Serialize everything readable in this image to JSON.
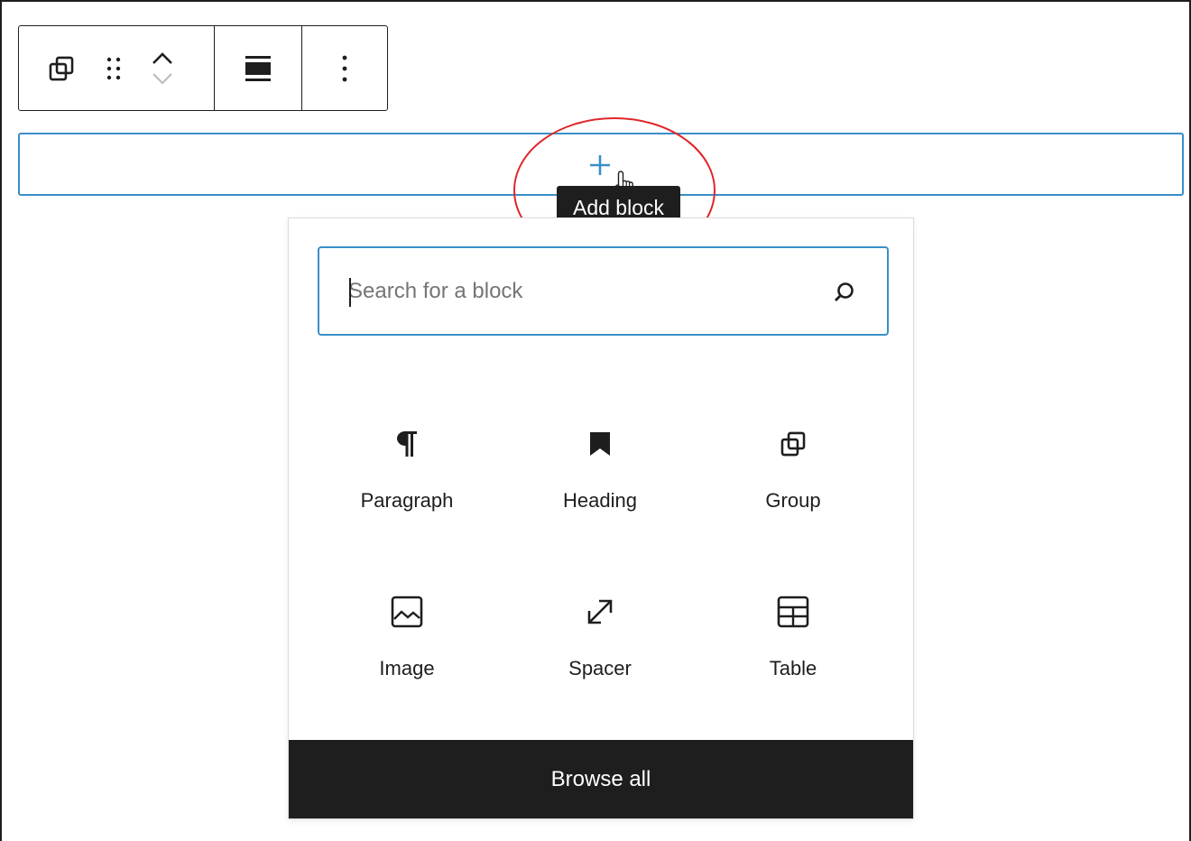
{
  "tooltip": {
    "text": "Add block"
  },
  "search": {
    "placeholder": "Search for a block",
    "value": ""
  },
  "blocks": [
    {
      "label": "Paragraph",
      "icon": "paragraph-icon"
    },
    {
      "label": "Heading",
      "icon": "bookmark-icon"
    },
    {
      "label": "Group",
      "icon": "group-icon"
    },
    {
      "label": "Image",
      "icon": "image-icon"
    },
    {
      "label": "Spacer",
      "icon": "resize-arrows-icon"
    },
    {
      "label": "Table",
      "icon": "table-icon"
    }
  ],
  "footer": {
    "browse_all_label": "Browse all"
  },
  "colors": {
    "accent": "#3a8fc7",
    "dark": "#1e1e1e",
    "annotation": "#e0262b"
  }
}
